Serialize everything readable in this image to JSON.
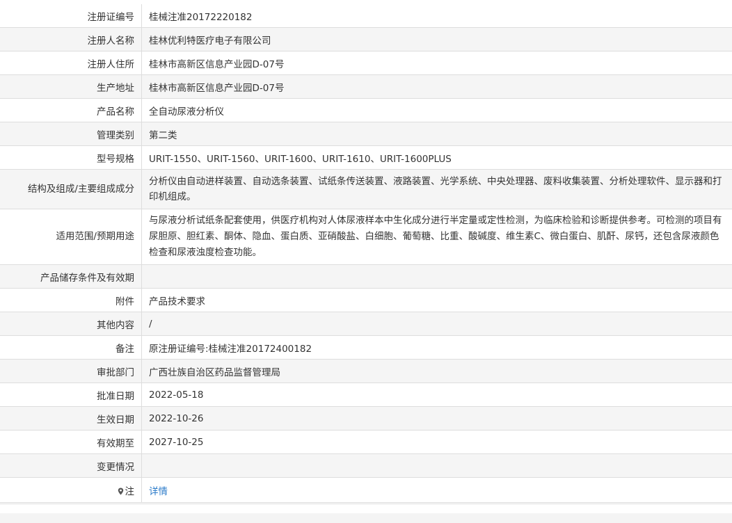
{
  "rows": [
    {
      "label": "注册证编号",
      "value": "桂械注准20172220182"
    },
    {
      "label": "注册人名称",
      "value": "桂林优利特医疗电子有限公司"
    },
    {
      "label": "注册人住所",
      "value": "桂林市高新区信息产业园D-07号"
    },
    {
      "label": "生产地址",
      "value": "桂林市高新区信息产业园D-07号"
    },
    {
      "label": "产品名称",
      "value": "全自动尿液分析仪"
    },
    {
      "label": "管理类别",
      "value": "第二类"
    },
    {
      "label": "型号规格",
      "value": "URIT-1550、URIT-1560、URIT-1600、URIT-1610、URIT-1600PLUS"
    },
    {
      "label": "结构及组成/主要组成成分",
      "value": "分析仪由自动进样装置、自动选条装置、试纸条传送装置、液路装置、光学系统、中央处理器、废料收集装置、分析处理软件、显示器和打印机组成。"
    },
    {
      "label": "适用范围/预期用途",
      "value": "与尿液分析试纸条配套使用，供医疗机构对人体尿液样本中生化成分进行半定量或定性检测，为临床检验和诊断提供参考。可检测的项目有尿胆原、胆红素、酮体、隐血、蛋白质、亚硝酸盐、白细胞、葡萄糖、比重、酸碱度、维生素C、微白蛋白、肌酐、尿钙，还包含尿液颜色检查和尿液浊度检查功能。"
    },
    {
      "label": "产品储存条件及有效期",
      "value": ""
    },
    {
      "label": "附件",
      "value": "产品技术要求"
    },
    {
      "label": "其他内容",
      "value": "/"
    },
    {
      "label": "备注",
      "value": "原注册证编号:桂械注准20172400182"
    },
    {
      "label": "审批部门",
      "value": "广西壮族自治区药品监督管理局"
    },
    {
      "label": "批准日期",
      "value": "2022-05-18"
    },
    {
      "label": "生效日期",
      "value": "2022-10-26"
    },
    {
      "label": "有效期至",
      "value": "2027-10-25"
    },
    {
      "label": "变更情况",
      "value": ""
    }
  ],
  "note": {
    "label": "注",
    "icon": "location-pin-icon",
    "link_text": "详情"
  },
  "colors": {
    "link": "#2b7bc9",
    "row_alt": "#f5f5f5",
    "border": "#dddddd"
  }
}
